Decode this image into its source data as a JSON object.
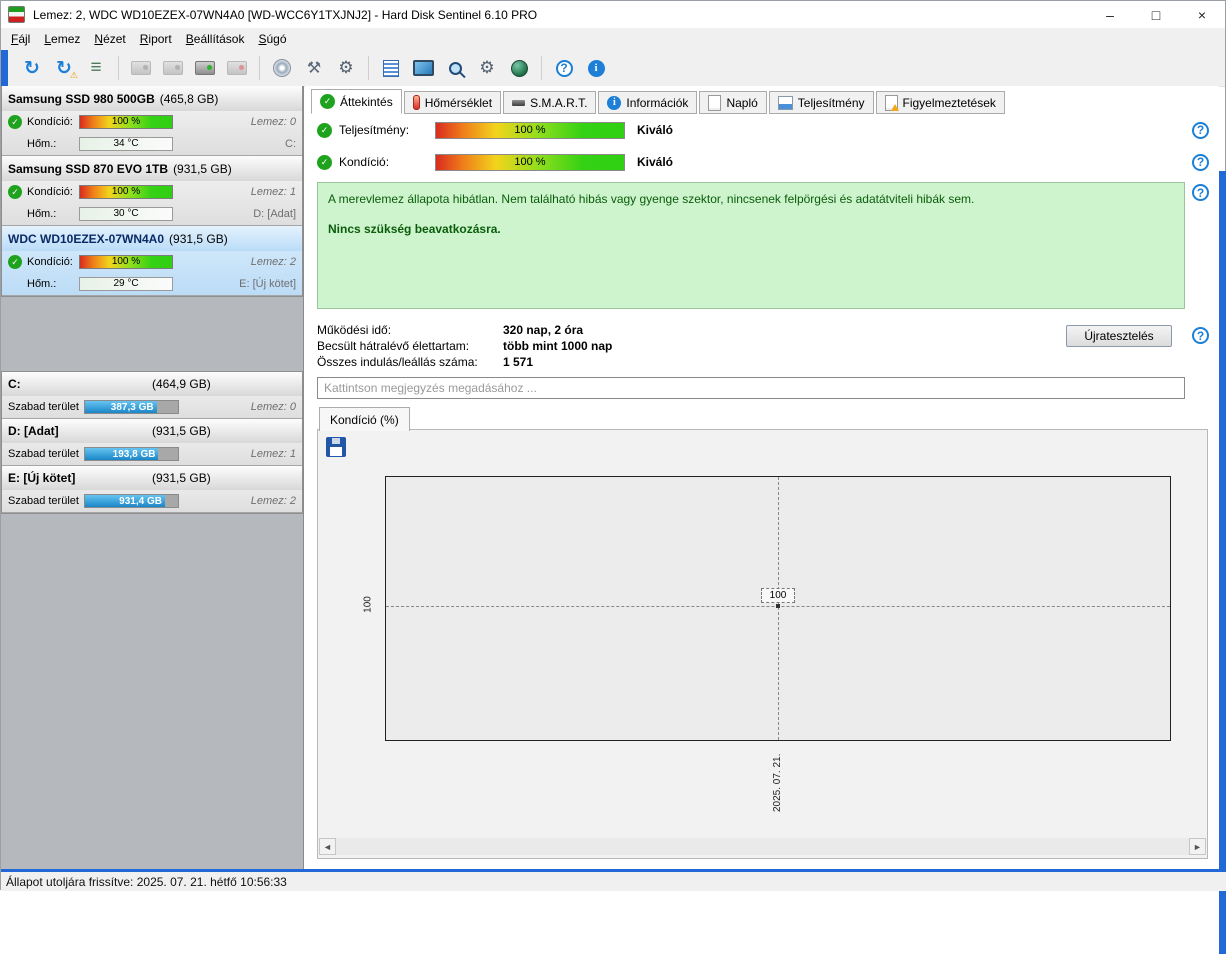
{
  "window": {
    "title": "Lemez: 2, WDC WD10EZEX-07WN4A0 [WD-WCC6Y1TXJNJ2]  -  Hard Disk Sentinel 6.10 PRO",
    "controls": {
      "minimize": "–",
      "maximize": "□",
      "close": "×"
    }
  },
  "menu": {
    "items": [
      {
        "label": "Fájl"
      },
      {
        "label": "Lemez"
      },
      {
        "label": "Nézet"
      },
      {
        "label": "Riport"
      },
      {
        "label": "Beállítások"
      },
      {
        "label": "Súgó"
      }
    ]
  },
  "toolbar": {
    "icons": [
      "refresh",
      "refresh-warning",
      "surface-details",
      "disk-back",
      "disk-eject",
      "disk-start",
      "disk-stop",
      "disc-burn",
      "hardware-tools",
      "settings-gear",
      "report-list",
      "monitor",
      "disk-seek",
      "gear-options",
      "world",
      "help",
      "information"
    ]
  },
  "sidebar": {
    "disks": [
      {
        "name": "Samsung SSD 980 500GB",
        "size": "(465,8 GB)",
        "condition_label": "Kondíció:",
        "condition_value": "100 %",
        "temp_label": "Hőm.:",
        "temp_value": "34 °C",
        "disk_label": "Lemez: 0",
        "volume": "C:"
      },
      {
        "name": "Samsung SSD 870 EVO 1TB",
        "size": "(931,5 GB)",
        "condition_label": "Kondíció:",
        "condition_value": "100 %",
        "temp_label": "Hőm.:",
        "temp_value": "30 °C",
        "disk_label": "Lemez: 1",
        "volume": "D: [Adat]"
      },
      {
        "name": "WDC WD10EZEX-07WN4A0",
        "size": "(931,5 GB)",
        "condition_label": "Kondíció:",
        "condition_value": "100 %",
        "temp_label": "Hőm.:",
        "temp_value": "29 °C",
        "disk_label": "Lemez: 2",
        "volume": "E: [Új kötet]"
      }
    ],
    "partitions": [
      {
        "name": "C:",
        "size": "(464,9 GB)",
        "free_label": "Szabad terület",
        "free_value": "387,3 GB",
        "disk_label": "Lemez: 0",
        "fill_pct": 77
      },
      {
        "name": "D: [Adat]",
        "size": "(931,5 GB)",
        "free_label": "Szabad terület",
        "free_value": "193,8 GB",
        "disk_label": "Lemez: 1",
        "fill_pct": 79
      },
      {
        "name": "E: [Új kötet]",
        "size": "(931,5 GB)",
        "free_label": "Szabad terület",
        "free_value": "931,4 GB",
        "disk_label": "Lemez: 2",
        "fill_pct": 86
      }
    ]
  },
  "tabs": {
    "items": [
      {
        "label": "Áttekintés"
      },
      {
        "label": "Hőmérséklet"
      },
      {
        "label": "S.M.A.R.T."
      },
      {
        "label": "Információk"
      },
      {
        "label": "Napló"
      },
      {
        "label": "Teljesítmény"
      },
      {
        "label": "Figyelmeztetések"
      }
    ]
  },
  "overview": {
    "performance_label": "Teljesítmény:",
    "performance_value": "100 %",
    "performance_rating": "Kiváló",
    "condition_label": "Kondíció:",
    "condition_value": "100 %",
    "condition_rating": "Kiváló",
    "health_text": "A merevlemez állapota hibátlan. Nem található hibás vagy gyenge szektor, nincsenek felpörgési és adatátviteli hibák sem.",
    "health_action": "Nincs szükség beavatkozásra.",
    "stats": [
      {
        "label": "Működési idő:",
        "value": "320 nap, 2 óra"
      },
      {
        "label": "Becsült hátralévő élettartam:",
        "value": "több mint 1000 nap"
      },
      {
        "label": "Összes indulás/leállás száma:",
        "value": "1 571"
      }
    ],
    "retest_button": "Újratesztelés",
    "comment_placeholder": "Kattintson megjegyzés megadásához ..."
  },
  "chart": {
    "tab_label": "Kondíció  (%)",
    "y_tick": "100",
    "point_label": "100",
    "x_label": "2025. 07. 21."
  },
  "chart_data": {
    "type": "line",
    "title": "Kondíció (%)",
    "x": [
      "2025. 07. 21."
    ],
    "series": [
      {
        "name": "Kondíció",
        "values": [
          100
        ]
      }
    ],
    "y_ticks": [
      100
    ],
    "grid": "dashed"
  },
  "statusbar": {
    "text": "Állapot utoljára frissítve: 2025. 07. 21. hétfő 10:56:33"
  },
  "colors": {
    "accent_blue": "#2268d6",
    "health_green_bg": "#cdf4cd",
    "ok_green": "#1fa31f",
    "free_bar_blue": "#1a86c8"
  }
}
